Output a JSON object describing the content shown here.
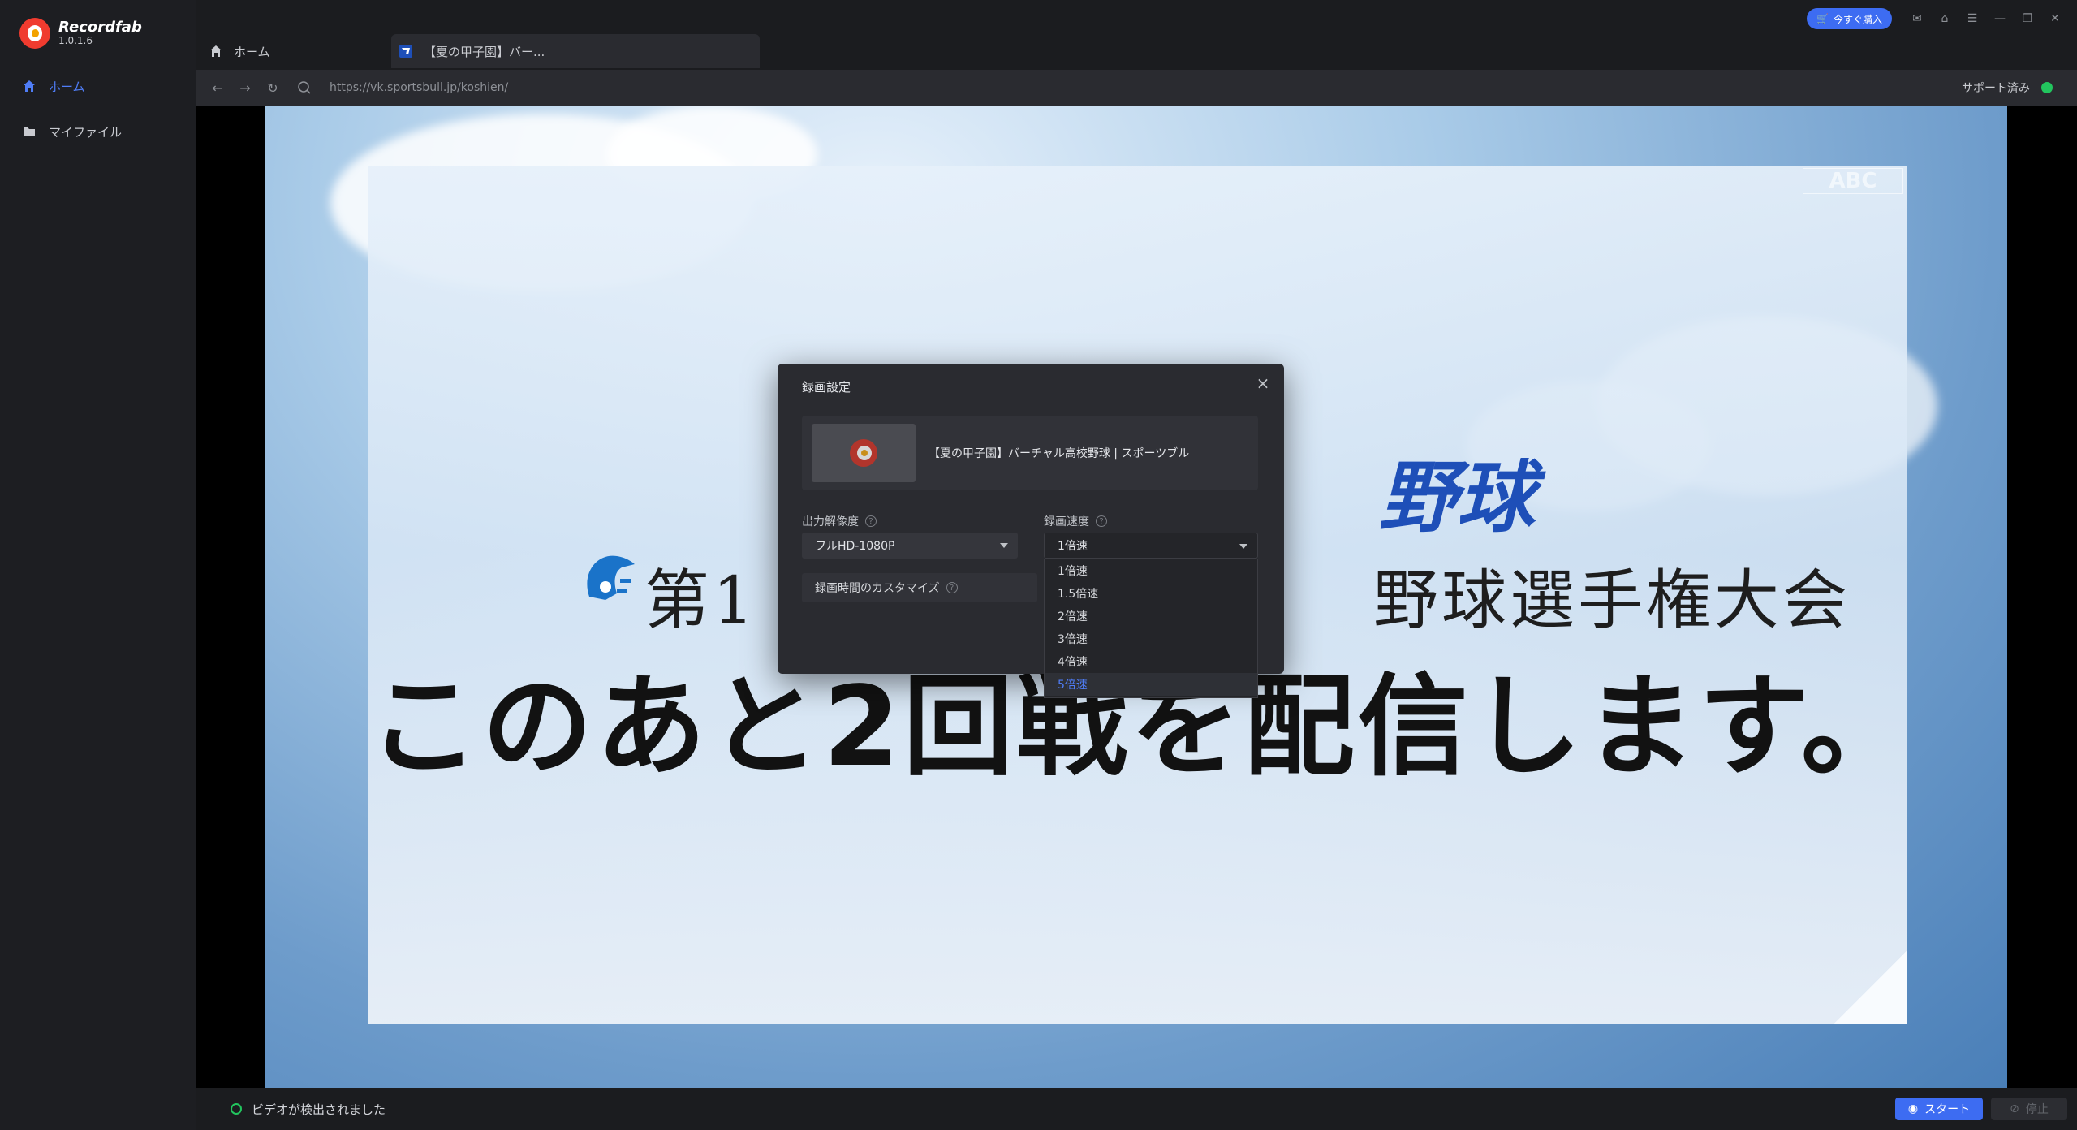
{
  "app": {
    "name": "Recordfab",
    "version": "1.0.1.6"
  },
  "sidebar": {
    "items": [
      {
        "label": "ホーム",
        "icon": "home-icon",
        "active": true
      },
      {
        "label": "マイファイル",
        "icon": "folder-icon",
        "active": false
      }
    ]
  },
  "tabs": [
    {
      "label": "ホーム",
      "icon": "home-icon"
    },
    {
      "label": "【夏の甲子園】バー...",
      "icon": "site-favicon"
    }
  ],
  "address_bar": {
    "url": "https://vk.sportsbull.jp/koshien/",
    "support_text": "サポート済み",
    "support_color": "#22c55e"
  },
  "window": {
    "buy_label": "今すぐ購入"
  },
  "video": {
    "brand_text": "野球",
    "title_left": "第1",
    "title_right": "野球選手権大会",
    "main_text": "このあと2回戦を配信します。",
    "watermark": "ABC"
  },
  "dialog": {
    "title": "録画設定",
    "video_title": "【夏の甲子園】バーチャル高校野球 | スポーツブル",
    "resolution_label": "出力解像度",
    "resolution_value": "フルHD-1080P",
    "speed_label": "録画速度",
    "speed_value": "1倍速",
    "custom_time_label": "録画時間のカスタマイズ",
    "speed_options": [
      "1倍速",
      "1.5倍速",
      "2倍速",
      "3倍速",
      "4倍速",
      "5倍速"
    ],
    "highlighted_option": "5倍速"
  },
  "status": {
    "message": "ビデオが検出されました",
    "start_label": "スタート",
    "stop_label": "停止"
  },
  "colors": {
    "accent": "#3d6cf2",
    "active_nav": "#4f7df7",
    "success": "#22c55e"
  }
}
